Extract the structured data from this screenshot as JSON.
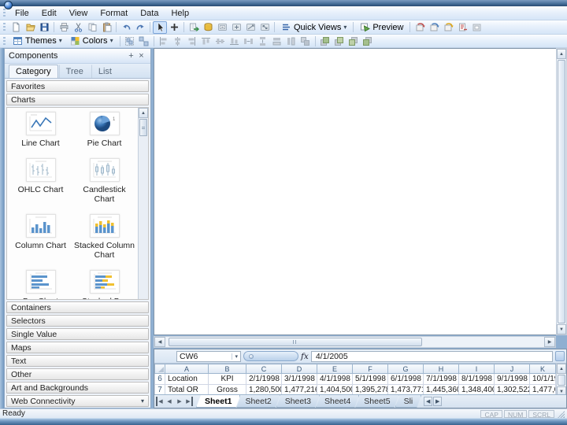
{
  "menu": {
    "items": [
      {
        "label": "File"
      },
      {
        "label": "Edit"
      },
      {
        "label": "View"
      },
      {
        "label": "Format"
      },
      {
        "label": "Data"
      },
      {
        "label": "Help"
      }
    ]
  },
  "toolbar": {
    "quick_views": "Quick Views",
    "preview": "Preview",
    "themes": "Themes",
    "colors": "Colors"
  },
  "panel": {
    "title": "Components",
    "tabs": [
      {
        "label": "Category"
      },
      {
        "label": "Tree"
      },
      {
        "label": "List"
      }
    ],
    "favorites": "Favorites",
    "charts_header": "Charts",
    "pie_badge": "1",
    "charts": [
      {
        "name": "Line Chart"
      },
      {
        "name": "Pie Chart"
      },
      {
        "name": "OHLC Chart"
      },
      {
        "name": "Candlestick Chart"
      },
      {
        "name": "Column Chart"
      },
      {
        "name": "Stacked Column Chart"
      },
      {
        "name": "Bar Chart"
      },
      {
        "name": "Stacked Bar Chart"
      }
    ],
    "sections": [
      {
        "label": "Containers"
      },
      {
        "label": "Selectors"
      },
      {
        "label": "Single Value"
      },
      {
        "label": "Maps"
      },
      {
        "label": "Text"
      },
      {
        "label": "Other"
      },
      {
        "label": "Art and Backgrounds"
      },
      {
        "label": "Web Connectivity"
      }
    ]
  },
  "spreadsheet": {
    "name_box": "CW6",
    "fx": "fx",
    "formula": "4/1/2005",
    "columns": [
      "A",
      "B",
      "C",
      "D",
      "E",
      "F",
      "G",
      "H",
      "I",
      "J",
      "K"
    ],
    "rows": [
      {
        "num": "6",
        "cells": [
          "Location",
          "KPI",
          "2/1/1998",
          "3/1/1998",
          "4/1/1998",
          "5/1/1998",
          "6/1/1998",
          "7/1/1998",
          "8/1/1998",
          "9/1/1998",
          "10/1/19"
        ]
      },
      {
        "num": "7",
        "cells": [
          "Total OR",
          "Gross",
          "1,280,500",
          "1,477,216",
          "1,404,500",
          "1,395,278",
          "1,473,771",
          "1,445,360",
          "1,348,400",
          "1,302,522",
          "1,477,0"
        ]
      }
    ],
    "tabs": [
      {
        "label": "Sheet1"
      },
      {
        "label": "Sheet2"
      },
      {
        "label": "Sheet3"
      },
      {
        "label": "Sheet4"
      },
      {
        "label": "Sheet5"
      },
      {
        "label": "Sli"
      }
    ]
  },
  "status": {
    "ready": "Ready",
    "indicators": [
      {
        "label": "CAP"
      },
      {
        "label": "NUM"
      },
      {
        "label": "SCRL"
      }
    ]
  },
  "icons": {
    "dropdown": "▾",
    "pin": "+",
    "close": "×",
    "up": "▲",
    "down": "▼",
    "left": "◀",
    "right": "▶"
  }
}
